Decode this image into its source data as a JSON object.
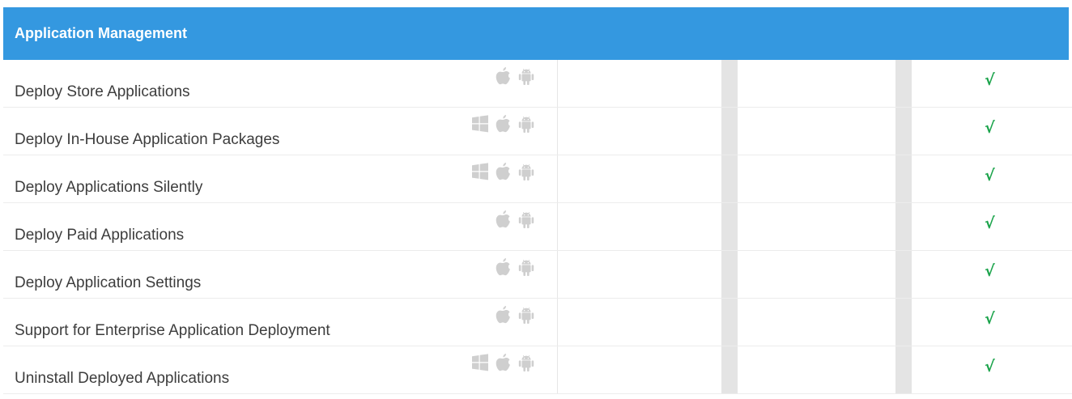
{
  "colors": {
    "header": "#3498e0",
    "check": "#1aa34a",
    "icon": "#cfcfcf"
  },
  "section": {
    "title": "Application Management"
  },
  "rows": [
    {
      "label": "Deploy Store Applications",
      "platforms": [
        "apple-icon",
        "android-icon"
      ],
      "col2": "",
      "col3": "",
      "col4": "√"
    },
    {
      "label": "Deploy In-House Application Packages",
      "platforms": [
        "windows-icon",
        "apple-icon",
        "android-icon"
      ],
      "col2": "",
      "col3": "",
      "col4": "√"
    },
    {
      "label": "Deploy Applications Silently",
      "platforms": [
        "windows-icon",
        "apple-icon",
        "android-icon"
      ],
      "col2": "",
      "col3": "",
      "col4": "√"
    },
    {
      "label": "Deploy Paid Applications",
      "platforms": [
        "apple-icon",
        "android-icon"
      ],
      "col2": "",
      "col3": "",
      "col4": "√"
    },
    {
      "label": "Deploy Application Settings",
      "platforms": [
        "apple-icon",
        "android-icon"
      ],
      "col2": "",
      "col3": "",
      "col4": "√"
    },
    {
      "label": "Support for Enterprise Application Deployment",
      "platforms": [
        "apple-icon",
        "android-icon"
      ],
      "col2": "",
      "col3": "",
      "col4": "√"
    },
    {
      "label": "Uninstall Deployed Applications",
      "platforms": [
        "windows-icon",
        "apple-icon",
        "android-icon"
      ],
      "col2": "",
      "col3": "",
      "col4": "√"
    }
  ]
}
